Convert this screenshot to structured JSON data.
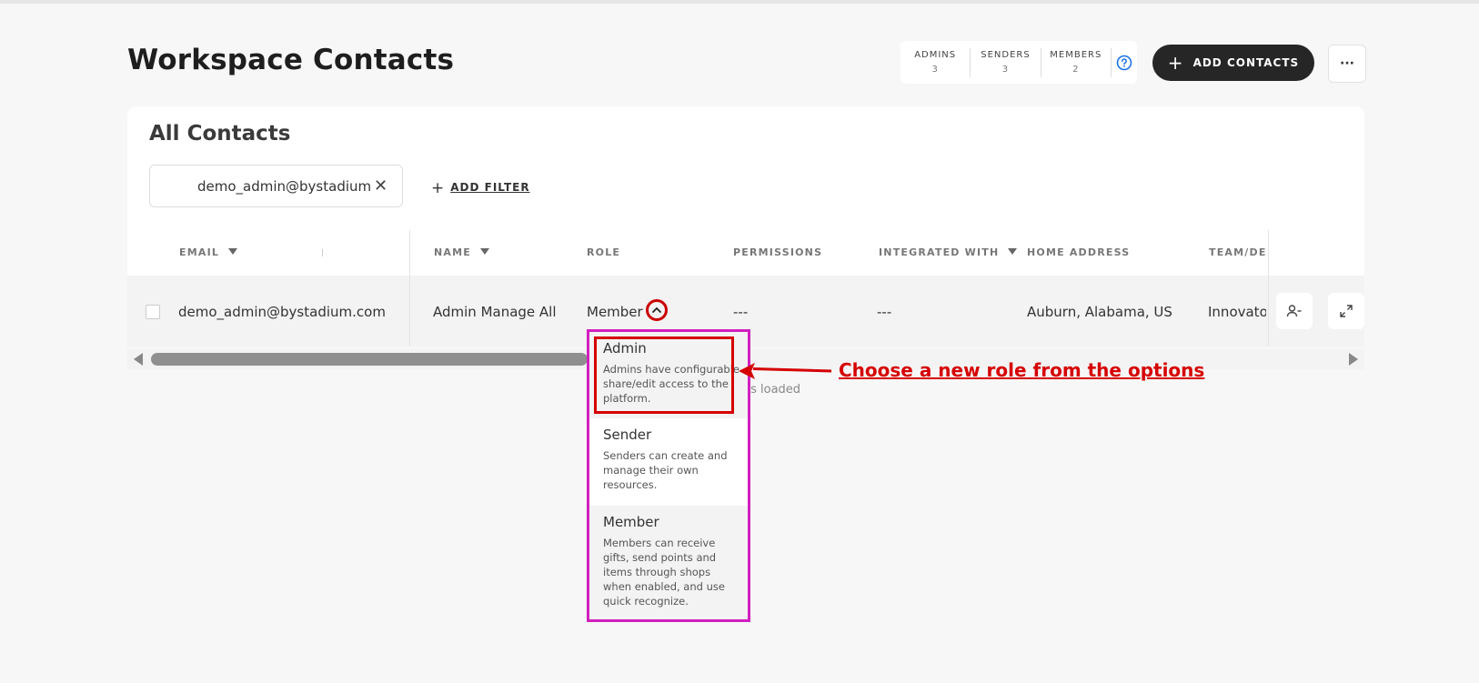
{
  "header": {
    "title": "Workspace Contacts",
    "counts": [
      {
        "label": "ADMINS",
        "value": "3"
      },
      {
        "label": "SENDERS",
        "value": "3"
      },
      {
        "label": "MEMBERS",
        "value": "2"
      }
    ],
    "add_contacts_label": "ADD CONTACTS",
    "more_label": "···"
  },
  "card": {
    "title": "All Contacts",
    "filter_value": "demo_admin@bystadium",
    "add_filter_label": "ADD FILTER"
  },
  "table": {
    "columns": [
      "EMAIL",
      "NAME",
      "ROLE",
      "PERMISSIONS",
      "INTEGRATED WITH",
      "HOME ADDRESS",
      "TEAM/DE"
    ],
    "row": {
      "email": "demo_admin@bystadium.com",
      "name": "Admin Manage All",
      "role": "Member",
      "permissions": "---",
      "integrated_with": "---",
      "home_address": "Auburn, Alabama, US",
      "team": "Innovato"
    },
    "loaded_text": "ts loaded"
  },
  "role_dropdown": {
    "options": [
      {
        "title": "Admin",
        "description": "Admins have configurable share/edit access to the platform."
      },
      {
        "title": "Sender",
        "description": "Senders can create and manage their own resources."
      },
      {
        "title": "Member",
        "description": "Members can receive gifts, send points and items through shops when enabled, and use quick recognize."
      }
    ]
  },
  "annotation": {
    "text": "Choose a new role from the options",
    "color": "#d60000"
  },
  "colors": {
    "dropdown_border": "#d21fbf",
    "highlight": "#d60000",
    "primary_button": "#262626",
    "help": "#1a73e8"
  }
}
